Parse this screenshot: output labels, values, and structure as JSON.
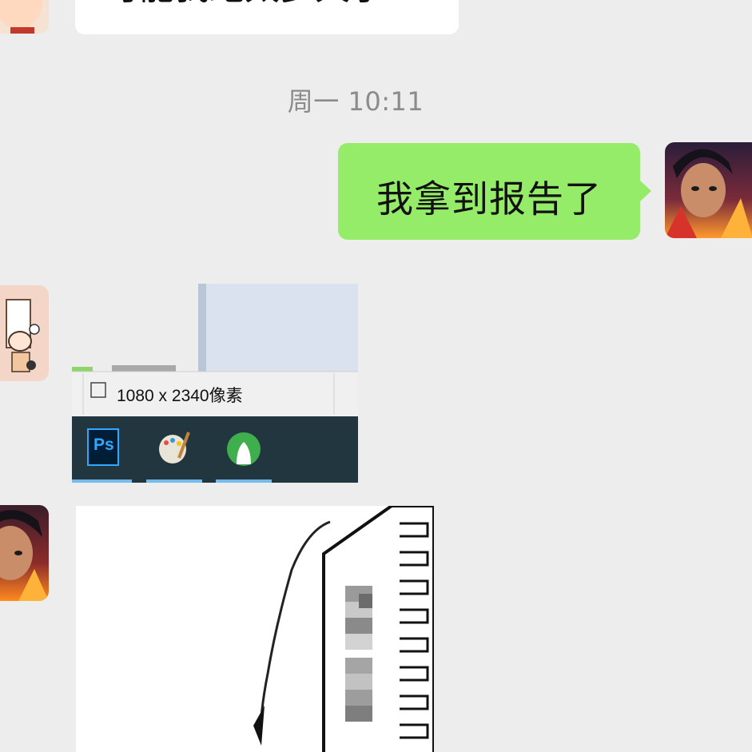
{
  "messages": {
    "top_partial_text": "可能我跑太多天了",
    "timestamp": "周一 10:11",
    "sent_text": "我拿到报告了"
  },
  "screenshot_image": {
    "dimensions_text": "1080 x 2340像素",
    "taskbar_icons": [
      "photoshop-icon",
      "paint-palette-icon",
      "green-vase-app-icon"
    ],
    "ps_label": "Ps"
  },
  "meme_image": {
    "description_icon": "cartoon-tower-computer-icon"
  },
  "colors": {
    "background": "#ededed",
    "sent_bubble": "#95ec69",
    "received_bubble": "#ffffff",
    "timestamp": "#8b8b8b"
  }
}
